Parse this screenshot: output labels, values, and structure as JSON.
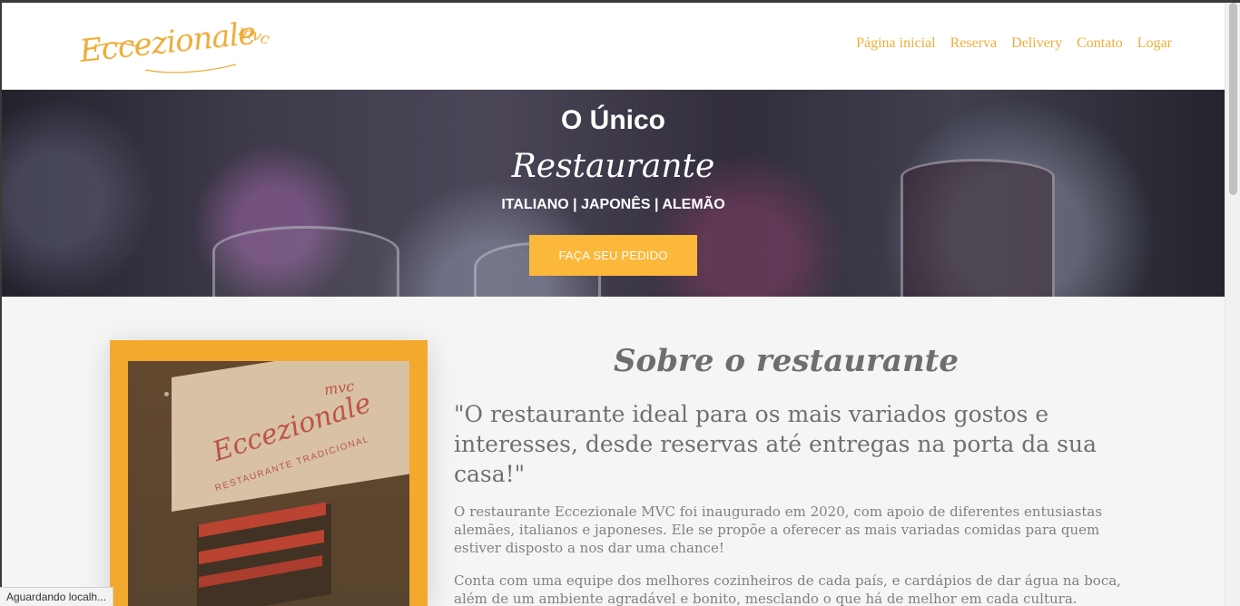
{
  "brand": {
    "logo_script": "Eccezionale",
    "logo_mvc": "mvc",
    "accent_color": "#f0ad3a",
    "button_color": "#fbb83a"
  },
  "nav": {
    "items": [
      "Página inicial",
      "Reserva",
      "Delivery",
      "Contato",
      "Logar"
    ]
  },
  "hero": {
    "title": "O Único",
    "script": "Restaurante",
    "cuisines": "ITALIANO | JAPONÊS | ALEMÃO",
    "button_label": "FAÇA SEU PEDIDO"
  },
  "about": {
    "sign_script": "Eccezionale",
    "sign_mvc": "mvc",
    "sign_subtitle": "RESTAURANTE TRADICIONAL",
    "heading": "Sobre o restaurante",
    "quote": "\"O restaurante ideal para os mais variados gostos e interesses, desde reservas até entregas na porta da sua casa!\"",
    "paragraph1": "O restaurante Eccezionale MVC foi inaugurado em 2020, com apoio de diferentes entusiastas alemães, italianos e japoneses. Ele se propõe a oferecer as mais variadas comidas para quem estiver disposto a nos dar uma chance!",
    "paragraph2": "Conta com uma equipe dos melhores cozinheiros de cada país, e cardápios de dar água na boca, além de um ambiente agradável e bonito, mesclando o que há de melhor em cada cultura."
  },
  "status_bar": {
    "text": "Aguardando localh..."
  }
}
